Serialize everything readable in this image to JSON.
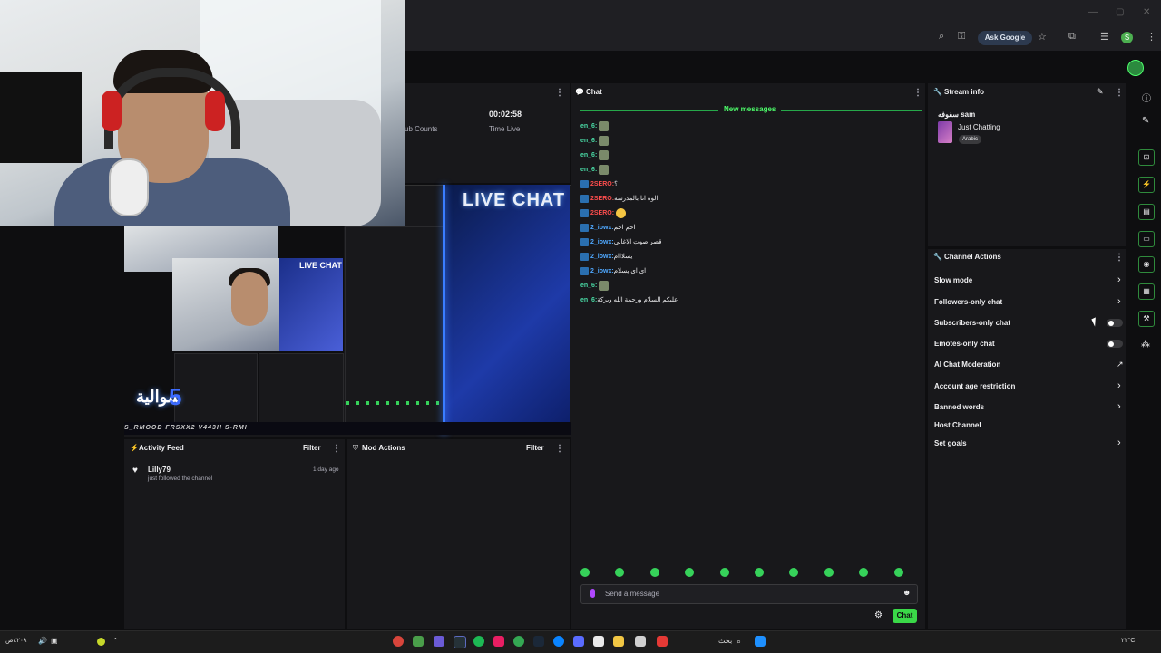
{
  "browser": {
    "ask_google": "Ask Google"
  },
  "stats": {
    "time_value": "00:02:58",
    "time_label": "Time Live",
    "sub_label": "ub Counts"
  },
  "preview": {
    "live_chat": "LIVE CHAT",
    "nested_live": "LIVE CHAT",
    "logo_text": "سوالية",
    "logo_five": "5",
    "ticker": "S_RMOOD   FRSXX2   V443H   S-RMI"
  },
  "chat": {
    "title": "Chat",
    "new_messages": "New messages",
    "messages": [
      {
        "user": "en_6:",
        "text": "",
        "style": "green",
        "emote": "gray"
      },
      {
        "user": "en_6:",
        "text": "",
        "style": "green",
        "emote": "gray"
      },
      {
        "user": "en_6:",
        "text": "",
        "style": "green",
        "emote": "gray"
      },
      {
        "user": "en_6:",
        "text": "",
        "style": "green",
        "emote": "gray"
      },
      {
        "user": "2SERO:",
        "text": "؟",
        "style": "red",
        "emote": ""
      },
      {
        "user": "2SERO:",
        "text": "الوه انا بالمدرسه",
        "style": "red",
        "emote": ""
      },
      {
        "user": "2SERO:",
        "text": "",
        "style": "red",
        "emote": "yellow"
      },
      {
        "user": "2_iowx:",
        "text": "احم احم",
        "style": "blue",
        "emote": ""
      },
      {
        "user": "2_iowx:",
        "text": "قصر صوت الاغاني",
        "style": "blue",
        "emote": ""
      },
      {
        "user": "2_iowx:",
        "text": "يسلااام",
        "style": "blue",
        "emote": ""
      },
      {
        "user": "2_iowx:",
        "text": "اي اي يسلام",
        "style": "blue",
        "emote": ""
      },
      {
        "user": "en_6:",
        "text": "",
        "style": "green",
        "emote": "gray"
      },
      {
        "user": "en_6:",
        "text": "عليكم السلام ورحمة الله وبركة",
        "style": "green",
        "emote": ""
      }
    ],
    "send_placeholder": "Send a message",
    "chat_button": "Chat"
  },
  "stream_info": {
    "title": "Stream info",
    "stream_title": "سفوفه sam",
    "category": "Just Chatting",
    "tag": "Arabic"
  },
  "channel_actions": {
    "title": "Channel Actions",
    "items": [
      {
        "label": "Slow mode",
        "control": "chevron"
      },
      {
        "label": "Followers-only chat",
        "control": "chevron"
      },
      {
        "label": "Subscribers-only chat",
        "control": "toggle"
      },
      {
        "label": "Emotes-only chat",
        "control": "toggle"
      },
      {
        "label": "AI Chat Moderation",
        "control": "trend"
      },
      {
        "label": "Account age restriction",
        "control": "chevron"
      },
      {
        "label": "Banned words",
        "control": "chevron"
      },
      {
        "label": "Host Channel",
        "control": "none"
      },
      {
        "label": "Set goals",
        "control": "chevron"
      }
    ]
  },
  "activity_feed": {
    "title": "Activity Feed",
    "filter": "Filter",
    "items": [
      {
        "user": "Lilly79",
        "action": "just followed the channel",
        "time": "1 day ago"
      }
    ]
  },
  "mod_actions": {
    "title": "Mod Actions",
    "filter": "Filter"
  },
  "taskbar": {
    "search": "بحث",
    "tray_left": "٤٢٠٨ص",
    "tray_right": "٢٢°C"
  },
  "colors": {
    "accent_green": "#3ad948",
    "background": "#0e0e10",
    "panel": "#18181b"
  }
}
